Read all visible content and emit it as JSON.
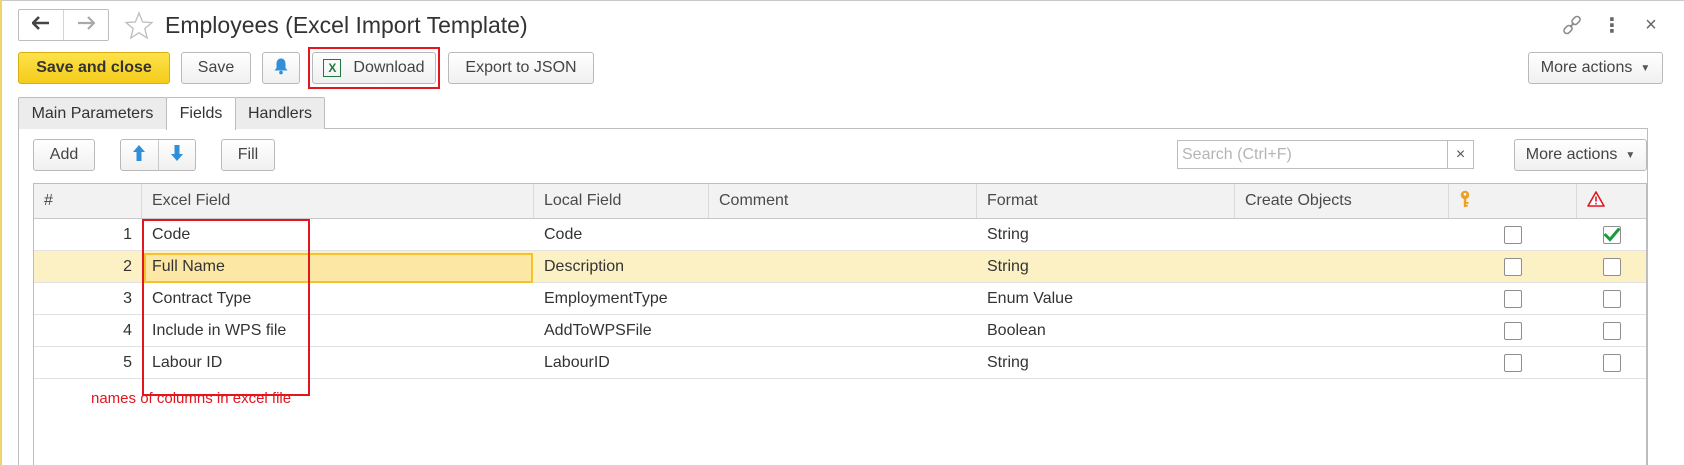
{
  "window": {
    "title": "Employees (Excel Import Template)",
    "back_icon": "arrow-left-icon",
    "forward_icon": "arrow-right-icon",
    "favorite_icon": "star-icon",
    "link_icon": "link-icon",
    "menu_icon": "vertical-dots-icon",
    "close_icon": "close-icon",
    "close_glyph": "×",
    "more_glyph": "⋮"
  },
  "toolbar": {
    "save_and_close": "Save and close",
    "save": "Save",
    "bell_icon": "bell-icon",
    "download": "Download",
    "download_icon": "excel-icon",
    "excel_glyph": "X",
    "export_json": "Export to JSON",
    "more_actions": "More actions"
  },
  "tabs": [
    {
      "label": "Main Parameters",
      "active": false
    },
    {
      "label": "Fields",
      "active": true
    },
    {
      "label": "Handlers",
      "active": false
    }
  ],
  "fields_toolbar": {
    "add": "Add",
    "move_up_icon": "arrow-up-icon",
    "move_down_icon": "arrow-down-icon",
    "fill": "Fill",
    "search_placeholder": "Search (Ctrl+F)",
    "search_value": "",
    "clear_glyph": "×",
    "more_actions": "More actions"
  },
  "table": {
    "columns": [
      "#",
      "Excel Field",
      "Local Field",
      "Comment",
      "Format",
      "Create Objects",
      "key-icon",
      "warning-icon"
    ],
    "rows": [
      {
        "num": "1",
        "excel_field": "Code",
        "local_field": "Code",
        "comment": "",
        "format": "String",
        "create_objects": "",
        "key": false,
        "required": true,
        "selected": false
      },
      {
        "num": "2",
        "excel_field": "Full Name",
        "local_field": "Description",
        "comment": "",
        "format": "String",
        "create_objects": "",
        "key": false,
        "required": false,
        "selected": true
      },
      {
        "num": "3",
        "excel_field": "Contract Type",
        "local_field": "EmploymentType",
        "comment": "",
        "format": "Enum Value",
        "create_objects": "",
        "key": false,
        "required": false,
        "selected": false
      },
      {
        "num": "4",
        "excel_field": "Include in WPS file",
        "local_field": "AddToWPSFile",
        "comment": "",
        "format": "Boolean",
        "create_objects": "",
        "key": false,
        "required": false,
        "selected": false
      },
      {
        "num": "5",
        "excel_field": "Labour ID",
        "local_field": "LabourID",
        "comment": "",
        "format": "String",
        "create_objects": "",
        "key": false,
        "required": false,
        "selected": false
      }
    ]
  },
  "annotation": "names of columns in excel file",
  "colors": {
    "accent_yellow": "#f4cc1a",
    "highlight_red": "#e2161f",
    "selected_row": "#fcf1c4",
    "check_green": "#1a9a3a",
    "excel_green": "#1d7a3f",
    "arrow_blue": "#2f8fd8"
  }
}
